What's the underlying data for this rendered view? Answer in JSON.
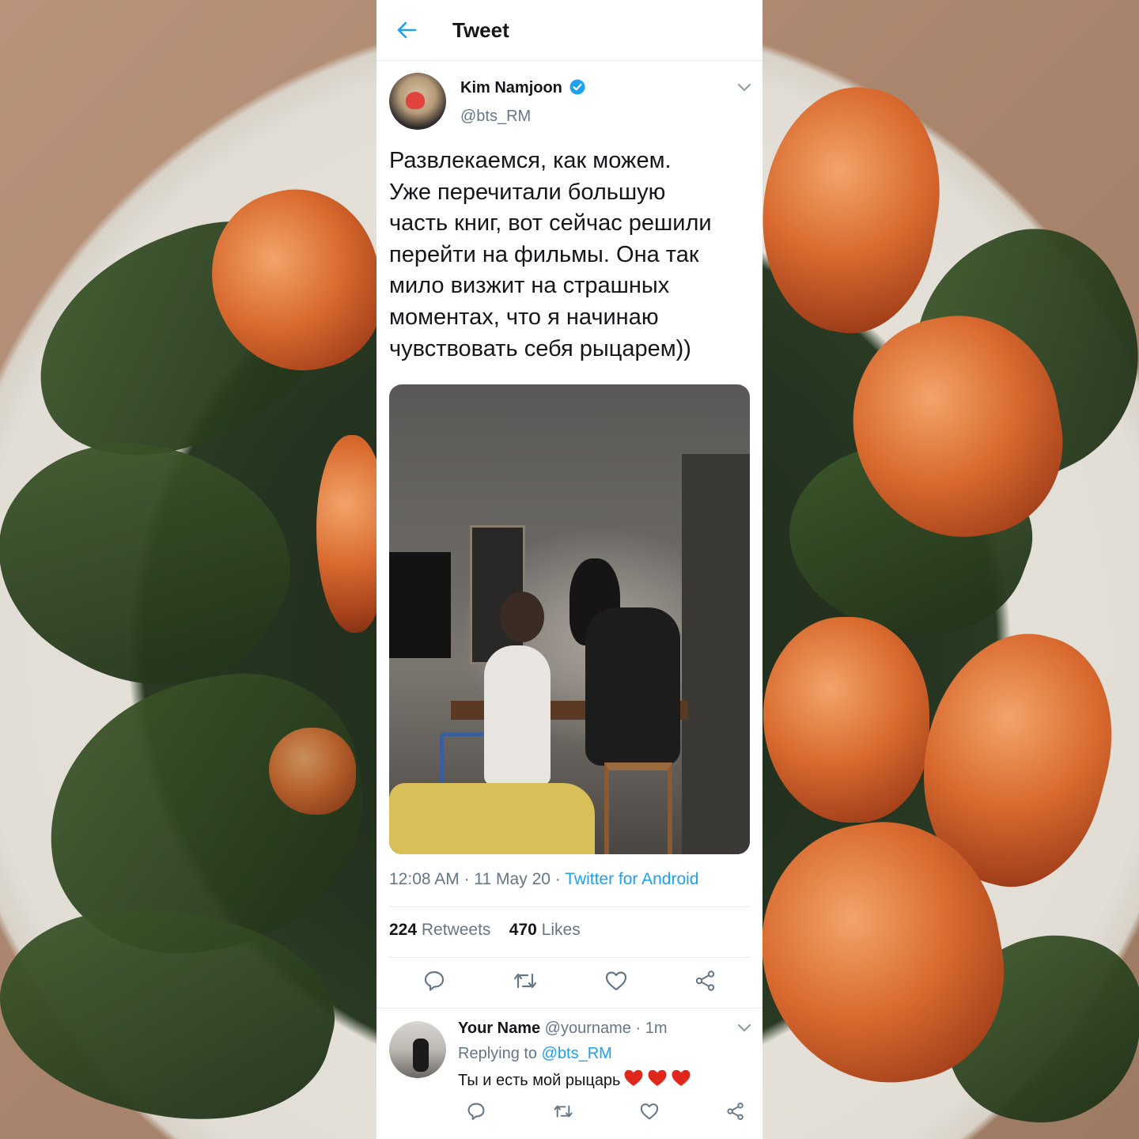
{
  "topbar": {
    "title": "Tweet"
  },
  "tweet": {
    "display_name": "Kim Namjoon",
    "handle": "@bts_RM",
    "text": "Развлекаемся, как можем.\nУже перечитали большую\nчасть книг, вот сейчас решили\nперейти на фильмы. Она так\nмило визжит на страшных\nмоментах, что я начинаю\nчувствовать себя рыцарем))",
    "time": "12:08 AM",
    "date": "11 May 20",
    "source": "Twitter for Android",
    "retweets_count": "224",
    "retweets_label": "Retweets",
    "likes_count": "470",
    "likes_label": "Likes"
  },
  "reply": {
    "display_name": "Your Name",
    "handle": "@yourname",
    "time": "1m",
    "replying_label": "Replying to",
    "replying_to": "@bts_RM",
    "text": "Ты и есть мой рыцарь"
  },
  "colors": {
    "accent": "#1da1f2",
    "secondary_text": "#657786",
    "heart": "#e0271b"
  },
  "icons": [
    "back-arrow-icon",
    "verified-icon",
    "chevron-down-icon",
    "reply-icon",
    "retweet-icon",
    "like-icon",
    "share-icon",
    "heart-emoji"
  ]
}
